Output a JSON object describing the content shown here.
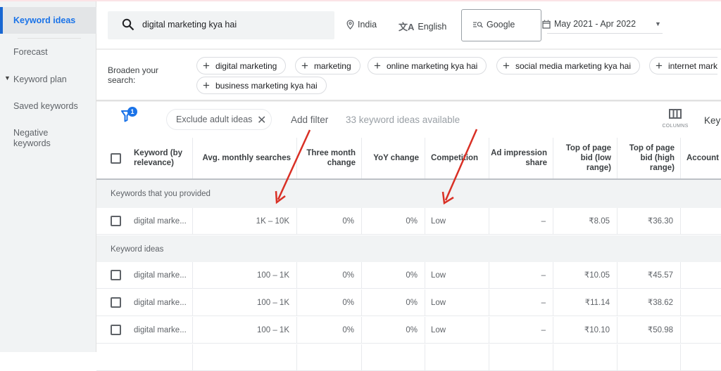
{
  "sidebar": {
    "items": [
      {
        "label": "Keyword ideas",
        "active": true
      },
      {
        "label": "Forecast"
      },
      {
        "label": "Keyword plan",
        "expandable": true
      },
      {
        "label": "Saved keywords"
      },
      {
        "label": "Negative keywords"
      }
    ]
  },
  "header": {
    "search_query": "digital marketing kya hai",
    "location": "India",
    "language": "English",
    "network": "Google",
    "date_range": "May 2021 - Apr 2022"
  },
  "broaden": {
    "label": "Broaden your search:",
    "chips": [
      "digital marketing",
      "marketing",
      "online marketing kya hai",
      "social media marketing kya hai",
      "internet mark",
      "business marketing kya hai"
    ]
  },
  "filters": {
    "active_count": "1",
    "chip_label": "Exclude adult ideas",
    "add_filter_label": "Add filter",
    "ideas_count_text": "33 keyword ideas available",
    "columns_label": "COLUMNS",
    "trailing_label": "Key"
  },
  "table": {
    "headers": [
      "Keyword (by relevance)",
      "Avg. monthly searches",
      "Three month change",
      "YoY change",
      "Competition",
      "Ad impression share",
      "Top of page bid (low range)",
      "Top of page bid (high range)",
      "Account S"
    ],
    "groups": [
      {
        "label": "Keywords that you provided",
        "rows": [
          {
            "keyword": "digital marke...",
            "avg_searches": "1K – 10K",
            "three_month": "0%",
            "yoy": "0%",
            "competition": "Low",
            "ad_share": "–",
            "bid_low": "₹8.05",
            "bid_high": "₹36.30",
            "account": ""
          }
        ]
      },
      {
        "label": "Keyword ideas",
        "rows": [
          {
            "keyword": "digital marke...",
            "avg_searches": "100 – 1K",
            "three_month": "0%",
            "yoy": "0%",
            "competition": "Low",
            "ad_share": "–",
            "bid_low": "₹10.05",
            "bid_high": "₹45.57",
            "account": ""
          },
          {
            "keyword": "digital marke...",
            "avg_searches": "100 – 1K",
            "three_month": "0%",
            "yoy": "0%",
            "competition": "Low",
            "ad_share": "–",
            "bid_low": "₹11.14",
            "bid_high": "₹38.62",
            "account": ""
          },
          {
            "keyword": "digital marke...",
            "avg_searches": "100 – 1K",
            "three_month": "0%",
            "yoy": "0%",
            "competition": "Low",
            "ad_share": "–",
            "bid_low": "₹10.10",
            "bid_high": "₹50.98",
            "account": ""
          }
        ]
      }
    ]
  },
  "annotations": {
    "arrow_color": "#d93025"
  }
}
